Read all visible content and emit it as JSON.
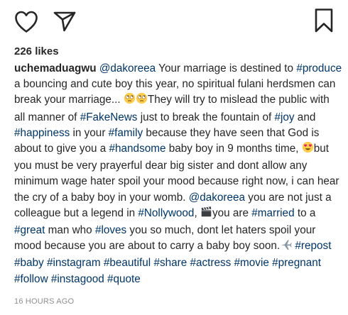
{
  "likes": "226 likes",
  "username": "uchemaduagwu",
  "caption_segments": [
    {
      "t": "mention",
      "v": "@dakoreea"
    },
    {
      "t": "text",
      "v": "  Your marriage is destined to "
    },
    {
      "t": "tag",
      "v": "#produce"
    },
    {
      "t": "text",
      "v": " a bouncing and cute boy this year, no spiritual fulani herdsmen can break your marriage... "
    },
    {
      "t": "emoji",
      "v": "rolling-eyes"
    },
    {
      "t": "emoji",
      "v": "rolling-eyes"
    },
    {
      "t": "text",
      "v": "They will try to mislead the public with all manner of "
    },
    {
      "t": "tag",
      "v": "#FakeNews"
    },
    {
      "t": "text",
      "v": " just to break the fountain of "
    },
    {
      "t": "tag",
      "v": "#joy"
    },
    {
      "t": "text",
      "v": " and "
    },
    {
      "t": "tag",
      "v": "#happiness"
    },
    {
      "t": "text",
      "v": " in your "
    },
    {
      "t": "tag",
      "v": "#family"
    },
    {
      "t": "text",
      "v": " because they have seen that God is about to give you a "
    },
    {
      "t": "tag",
      "v": "#handsome"
    },
    {
      "t": "text",
      "v": " baby boy in 9 months time, "
    },
    {
      "t": "emoji",
      "v": "heart-eyes"
    },
    {
      "t": "text",
      "v": "but you must be very prayerful dear big sister and dont allow any minimum wage hater spoil your mood because right now, i can hear the cry of a baby boy in your womb.  "
    },
    {
      "t": "mention",
      "v": "@dakoreea"
    },
    {
      "t": "text",
      "v": "  you are not just a colleague but a legend in "
    },
    {
      "t": "tag",
      "v": "#Nollywood"
    },
    {
      "t": "text",
      "v": ", "
    },
    {
      "t": "emoji",
      "v": "clapper-board"
    },
    {
      "t": "text",
      "v": "you are "
    },
    {
      "t": "tag",
      "v": "#married"
    },
    {
      "t": "text",
      "v": " to a "
    },
    {
      "t": "tag",
      "v": "#great"
    },
    {
      "t": "text",
      "v": " man who "
    },
    {
      "t": "tag",
      "v": "#loves"
    },
    {
      "t": "text",
      "v": " you so much, dont let haters spoil your mood because you are about to carry a baby boy soon."
    },
    {
      "t": "emoji",
      "v": "airplane"
    },
    {
      "t": "text",
      "v": " "
    },
    {
      "t": "tag",
      "v": "#repost"
    },
    {
      "t": "text",
      "v": " "
    },
    {
      "t": "tag",
      "v": "#baby"
    },
    {
      "t": "text",
      "v": " "
    },
    {
      "t": "tag",
      "v": "#instagram"
    },
    {
      "t": "text",
      "v": " "
    },
    {
      "t": "tag",
      "v": "#beautiful"
    },
    {
      "t": "text",
      "v": " "
    },
    {
      "t": "tag",
      "v": "#share"
    },
    {
      "t": "text",
      "v": " "
    },
    {
      "t": "tag",
      "v": "#actress"
    },
    {
      "t": "text",
      "v": " "
    },
    {
      "t": "tag",
      "v": "#movie"
    },
    {
      "t": "text",
      "v": " "
    },
    {
      "t": "tag",
      "v": "#pregnant"
    },
    {
      "t": "text",
      "v": " "
    },
    {
      "t": "tag",
      "v": "#follow"
    },
    {
      "t": "text",
      "v": " "
    },
    {
      "t": "tag",
      "v": "#instagood"
    },
    {
      "t": "text",
      "v": " "
    },
    {
      "t": "tag",
      "v": "#quote"
    }
  ],
  "timestamp": "16 HOURS AGO",
  "colors": {
    "text": "#262626",
    "link": "#003569",
    "muted": "#8e8e8e"
  },
  "icons": {
    "like": "heart-outline-icon",
    "share": "paper-plane-icon",
    "save": "bookmark-outline-icon"
  }
}
